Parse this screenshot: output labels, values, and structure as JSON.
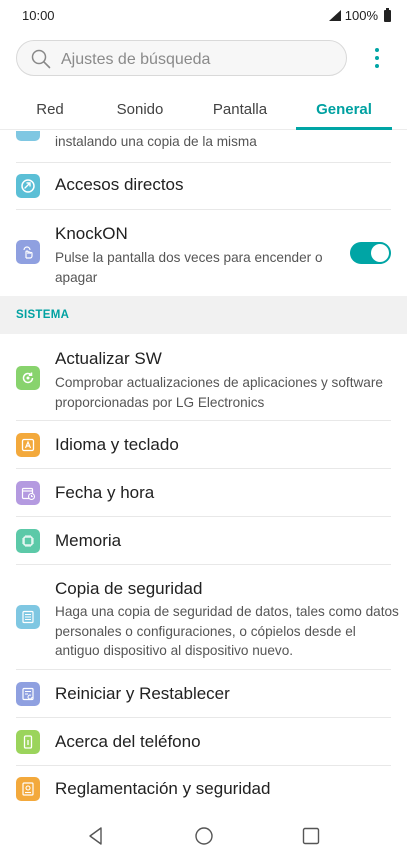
{
  "status": {
    "time": "10:00",
    "battery": "100%"
  },
  "search": {
    "placeholder": "Ajustes de búsqueda"
  },
  "tabs": [
    {
      "label": "Red"
    },
    {
      "label": "Sonido"
    },
    {
      "label": "Pantalla"
    },
    {
      "label": "General",
      "active": true
    }
  ],
  "items": {
    "partial": {
      "subtitle": "instalando una copia de la misma"
    },
    "shortcuts": {
      "title": "Accesos directos"
    },
    "knockon": {
      "title": "KnockON",
      "subtitle": "Pulse la pantalla dos veces para encender o apagar",
      "toggle_on": true
    },
    "section": {
      "label": "SISTEMA"
    },
    "update": {
      "title": "Actualizar SW",
      "subtitle": "Comprobar actualizaciones de aplicaciones y software proporcionadas por LG Electronics"
    },
    "language": {
      "title": "Idioma y teclado"
    },
    "datetime": {
      "title": "Fecha y hora"
    },
    "memory": {
      "title": "Memoria"
    },
    "backup": {
      "title": "Copia de seguridad",
      "subtitle": "Haga una copia de seguridad de datos, tales como datos personales o configuraciones, o cópielos desde el antiguo dispositivo al dispositivo nuevo."
    },
    "reset": {
      "title": "Reiniciar y Restablecer"
    },
    "about": {
      "title": "Acerca del teléfono"
    },
    "regulatory": {
      "title": "Reglamentación y seguridad"
    }
  },
  "icons": {
    "shortcuts": "circle-arrow-icon",
    "knockon": "hand-tap-icon",
    "update": "refresh-icon",
    "language": "keyboard-letter-icon",
    "datetime": "calendar-clock-icon",
    "memory": "chip-icon",
    "backup": "backup-list-icon",
    "reset": "reset-icon",
    "about": "phone-info-icon",
    "regulatory": "document-seal-icon"
  },
  "colors": {
    "accent": "#00a5a5",
    "icon_teal": "#5bbfd6",
    "icon_periwinkle": "#8fa0e0",
    "icon_green": "#88d36d",
    "icon_orange": "#f3a93c",
    "icon_purple": "#b49ae0",
    "icon_mint": "#5cc9a8",
    "icon_sky": "#7fc7e2",
    "icon_lime": "#9bd45c"
  }
}
